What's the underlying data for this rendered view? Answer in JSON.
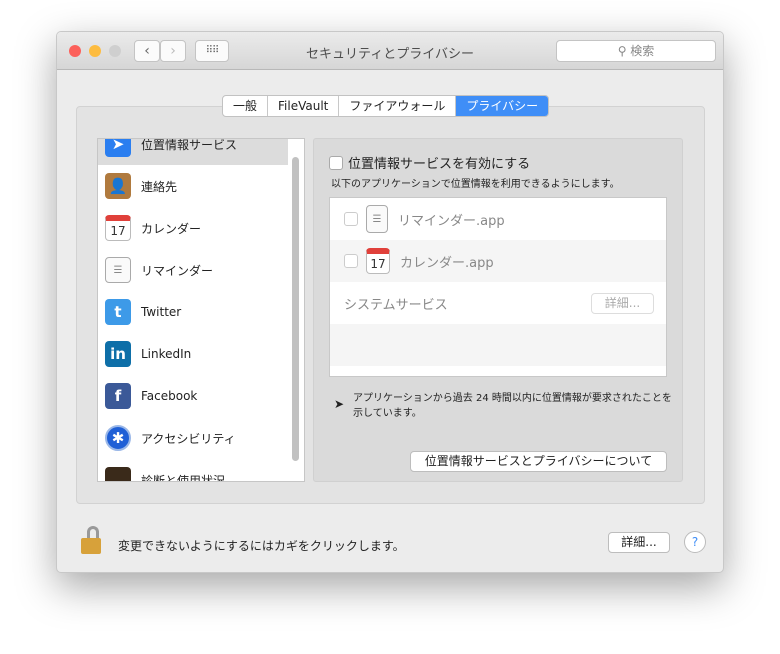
{
  "window": {
    "title": "セキュリティとプライバシー",
    "search_placeholder": "検索"
  },
  "tabs": [
    {
      "label": "一般"
    },
    {
      "label": "FileVault"
    },
    {
      "label": "ファイアウォール"
    },
    {
      "label": "プライバシー"
    }
  ],
  "sidebar": {
    "items": [
      {
        "label": "位置情報サービス"
      },
      {
        "label": "連絡先"
      },
      {
        "label": "カレンダー"
      },
      {
        "label": "リマインダー"
      },
      {
        "label": "Twitter"
      },
      {
        "label": "LinkedIn"
      },
      {
        "label": "Facebook"
      },
      {
        "label": "アクセシビリティ"
      },
      {
        "label": "診断と使用状況"
      }
    ]
  },
  "location": {
    "enable_label": "位置情報サービスを有効にする",
    "description": "以下のアプリケーションで位置情報を利用できるようにします。",
    "apps": [
      {
        "name": "リマインダー.app"
      },
      {
        "name": "カレンダー.app"
      }
    ],
    "system_services": "システムサービス",
    "details_button": "詳細...",
    "note": "アプリケーションから過去 24 時間以内に位置情報が要求されたことを示しています。",
    "about_button": "位置情報サービスとプライバシーについて"
  },
  "footer": {
    "lock_text": "変更できないようにするにはカギをクリックします。",
    "advanced_button": "詳細...",
    "help": "?"
  },
  "colors": {
    "accent": "#3f8ef7"
  }
}
